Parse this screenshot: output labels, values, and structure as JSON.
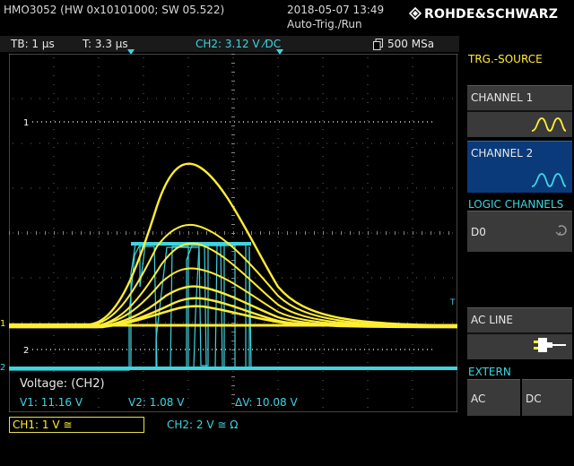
{
  "header": {
    "device": "HMO3052 (HW 0x10101000; SW 05.522)",
    "datetime": "2018-05-07 13:49",
    "mode": "Auto-Trig./Run",
    "brand": "ROHDE&SCHWARZ"
  },
  "settings": {
    "timebase": "TB: 1 µs",
    "trigger_time": "T: 3.3 µs",
    "trigger": "CH2: 3.12 V ⁄DC",
    "sample_rate": "500 MSa"
  },
  "markers": {
    "cursor1": "1",
    "cursor2": "2",
    "ch1_marker": "1",
    "ch2_marker": "2",
    "trigger_marker": "T"
  },
  "measurement": {
    "title": "Voltage: (CH2)",
    "v1": "V1: 11.16 V",
    "v2": "V2: 1.08 V",
    "dv": "ΔV: 10.08 V"
  },
  "channels": {
    "ch1": "CH1: 1 V ≅",
    "ch2": "CH2: 2 V ≅ Ω"
  },
  "menu": {
    "title": "TRG.-SOURCE",
    "channel1": "CHANNEL 1",
    "channel2": "CHANNEL 2",
    "logic_title": "LOGIC CHANNELS",
    "d0": "D0",
    "ac_line": "AC LINE",
    "extern_title": "EXTERN",
    "extern_ac": "AC",
    "extern_dc": "DC",
    "selected": "CHANNEL 2"
  },
  "colors": {
    "ch1": "#ffee33",
    "ch2": "#3fd4e0",
    "selected_softkey": "#0a3a7a",
    "softkey": "#3a3a3a"
  },
  "icons": {
    "brand_logo": "rohde-schwarz-diamond-icon",
    "memory": "memory-icon",
    "ch1_wave": "ch1-waveform-icon",
    "ch2_wave": "ch2-waveform-icon",
    "d0_return": "return-arrow-icon",
    "ac_plug": "power-plug-icon"
  }
}
